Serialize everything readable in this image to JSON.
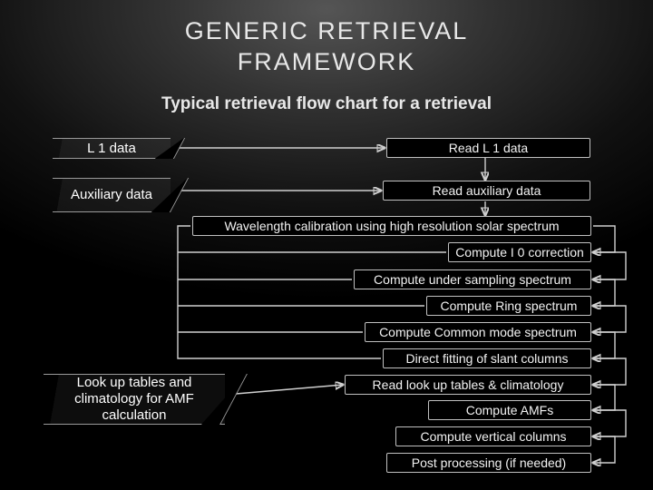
{
  "title_line1": "GENERIC RETRIEVAL",
  "title_line2": "FRAMEWORK",
  "subtitle": "Typical retrieval flow chart for a retrieval",
  "inputs": {
    "l1": "L 1 data",
    "aux": "Auxiliary data",
    "amf": "Look up tables and climatology for AMF calculation"
  },
  "steps": {
    "read_l1": "Read L 1 data",
    "read_aux": "Read auxiliary data",
    "wave_cal": "Wavelength calibration using high resolution solar spectrum",
    "i0": "Compute I 0 correction",
    "undersamp": "Compute under sampling spectrum",
    "ring": "Compute Ring spectrum",
    "common": "Compute Common mode spectrum",
    "slant": "Direct fitting of slant columns",
    "read_lut": "Read look up tables & climatology",
    "compute_amf": "Compute AMFs",
    "vertical": "Compute vertical columns",
    "post": "Post processing (if needed)"
  },
  "chart_data": {
    "type": "table",
    "title": "Typical retrieval flow chart for a retrieval",
    "nodes": [
      {
        "id": "l1",
        "kind": "input",
        "label": "L 1 data"
      },
      {
        "id": "aux",
        "kind": "input",
        "label": "Auxiliary data"
      },
      {
        "id": "amf_in",
        "kind": "input",
        "label": "Look up tables and climatology for AMF calculation"
      },
      {
        "id": "read_l1",
        "kind": "process",
        "label": "Read L 1 data"
      },
      {
        "id": "read_aux",
        "kind": "process",
        "label": "Read auxiliary data"
      },
      {
        "id": "wave_cal",
        "kind": "process",
        "label": "Wavelength calibration using high resolution solar spectrum"
      },
      {
        "id": "i0",
        "kind": "process",
        "label": "Compute I 0 correction"
      },
      {
        "id": "undersamp",
        "kind": "process",
        "label": "Compute under sampling spectrum"
      },
      {
        "id": "ring",
        "kind": "process",
        "label": "Compute Ring spectrum"
      },
      {
        "id": "common",
        "kind": "process",
        "label": "Compute Common mode spectrum"
      },
      {
        "id": "slant",
        "kind": "process",
        "label": "Direct fitting of slant columns"
      },
      {
        "id": "read_lut",
        "kind": "process",
        "label": "Read look up tables & climatology"
      },
      {
        "id": "compute_amf",
        "kind": "process",
        "label": "Compute AMFs"
      },
      {
        "id": "vertical",
        "kind": "process",
        "label": "Compute vertical columns"
      },
      {
        "id": "post",
        "kind": "process",
        "label": "Post processing (if needed)"
      }
    ],
    "edges": [
      [
        "l1",
        "read_l1"
      ],
      [
        "aux",
        "read_aux"
      ],
      [
        "read_l1",
        "read_aux"
      ],
      [
        "read_aux",
        "wave_cal"
      ],
      [
        "wave_cal",
        "i0"
      ],
      [
        "i0",
        "undersamp"
      ],
      [
        "undersamp",
        "ring"
      ],
      [
        "ring",
        "common"
      ],
      [
        "common",
        "slant"
      ],
      [
        "amf_in",
        "read_lut"
      ],
      [
        "slant",
        "read_lut"
      ],
      [
        "read_lut",
        "compute_amf"
      ],
      [
        "compute_amf",
        "vertical"
      ],
      [
        "vertical",
        "post"
      ]
    ]
  }
}
